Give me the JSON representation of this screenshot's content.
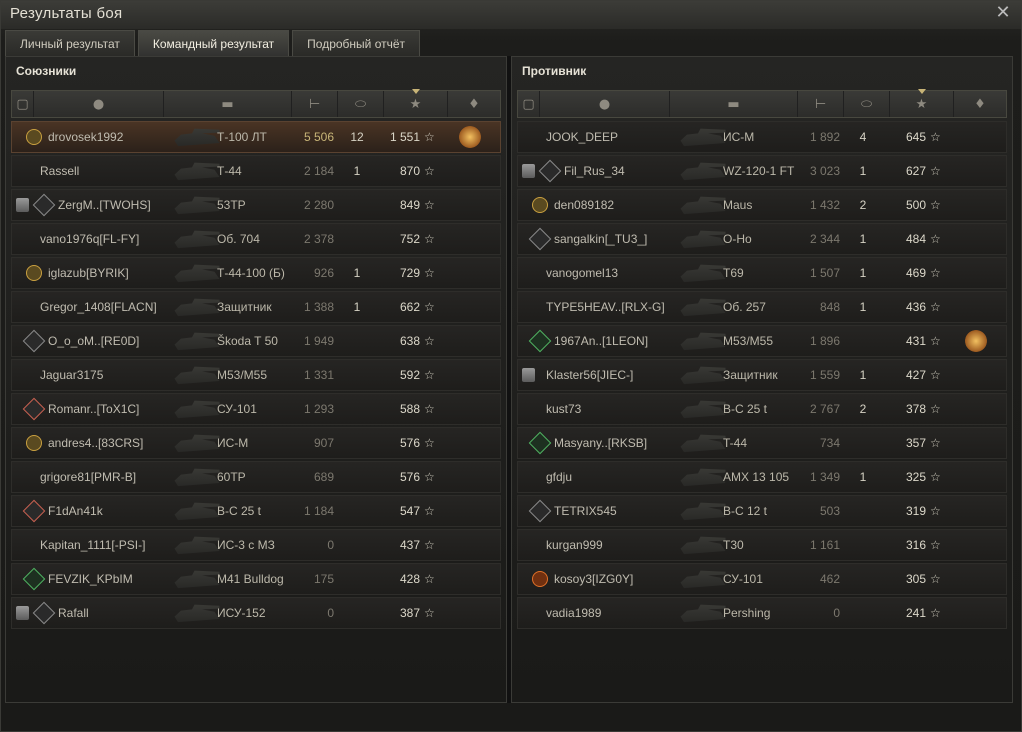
{
  "window": {
    "title": "Результаты боя"
  },
  "tabs": [
    {
      "label": "Личный результат",
      "active": false
    },
    {
      "label": "Командный результат",
      "active": true
    },
    {
      "label": "Подробный отчёт",
      "active": false
    }
  ],
  "allies": {
    "title": "Союзники",
    "rows": [
      {
        "name": "drovosek1992",
        "vehicle": "Т-100 ЛТ",
        "damage": "5 506",
        "kills": "12",
        "xp": "1 551",
        "squad": false,
        "badge": "gold",
        "medal": true,
        "me": true
      },
      {
        "name": "Rassell",
        "vehicle": "Т-44",
        "damage": "2 184",
        "kills": "1",
        "xp": "870",
        "squad": false,
        "badge": "",
        "medal": false
      },
      {
        "name": "ZergM..[TWOHS]",
        "vehicle": "53TP",
        "damage": "2 280",
        "kills": "",
        "xp": "849",
        "squad": true,
        "badge": "plain",
        "medal": false
      },
      {
        "name": "vano1976q[FL-FY]",
        "vehicle": "Об. 704",
        "damage": "2 378",
        "kills": "",
        "xp": "752",
        "squad": false,
        "badge": "",
        "medal": false
      },
      {
        "name": "iglazub[BYRIK]",
        "vehicle": "Т-44-100 (Б)",
        "damage": "926",
        "kills": "1",
        "xp": "729",
        "squad": false,
        "badge": "gold",
        "medal": false
      },
      {
        "name": "Gregor_1408[FLACN]",
        "vehicle": "Защитник",
        "damage": "1 388",
        "kills": "1",
        "xp": "662",
        "squad": false,
        "badge": "",
        "medal": false
      },
      {
        "name": "O_o_oM..[RE0D]",
        "vehicle": "Škoda T 50",
        "damage": "1 949",
        "kills": "",
        "xp": "638",
        "squad": false,
        "badge": "plain",
        "medal": false
      },
      {
        "name": "Jaguar3175",
        "vehicle": "M53/M55",
        "damage": "1 331",
        "kills": "",
        "xp": "592",
        "squad": false,
        "badge": "",
        "medal": false
      },
      {
        "name": "Romanr..[ToX1C]",
        "vehicle": "СУ-101",
        "damage": "1 293",
        "kills": "",
        "xp": "588",
        "squad": false,
        "badge": "red",
        "medal": false
      },
      {
        "name": "andres4..[83CRS]",
        "vehicle": "ИС-М",
        "damage": "907",
        "kills": "",
        "xp": "576",
        "squad": false,
        "badge": "gold",
        "medal": false
      },
      {
        "name": "grigore81[PMR-B]",
        "vehicle": "60TP",
        "damage": "689",
        "kills": "",
        "xp": "576",
        "squad": false,
        "badge": "",
        "medal": false
      },
      {
        "name": "F1dAn41k",
        "vehicle": "B-C 25 t",
        "damage": "1 184",
        "kills": "",
        "xp": "547",
        "squad": false,
        "badge": "red",
        "medal": false
      },
      {
        "name": "Kapitan_1111[-PSI-]",
        "vehicle": "ИС-3 с МЗ",
        "damage": "0",
        "kills": "",
        "xp": "437",
        "squad": false,
        "badge": "",
        "medal": false
      },
      {
        "name": "FEVZIK_KPbIM",
        "vehicle": "M41 Bulldog",
        "damage": "175",
        "kills": "",
        "xp": "428",
        "squad": false,
        "badge": "green",
        "medal": false
      },
      {
        "name": "Rafall",
        "vehicle": "ИСУ-152",
        "damage": "0",
        "kills": "",
        "xp": "387",
        "squad": true,
        "badge": "plain",
        "medal": false
      }
    ]
  },
  "enemies": {
    "title": "Противник",
    "rows": [
      {
        "name": "JOOK_DEEP",
        "vehicle": "ИС-М",
        "damage": "1 892",
        "kills": "4",
        "xp": "645",
        "squad": false,
        "badge": "",
        "medal": false
      },
      {
        "name": "Fil_Rus_34",
        "vehicle": "WZ-120-1 FT",
        "damage": "3 023",
        "kills": "1",
        "xp": "627",
        "squad": true,
        "badge": "plain",
        "medal": false
      },
      {
        "name": "den089182",
        "vehicle": "Maus",
        "damage": "1 432",
        "kills": "2",
        "xp": "500",
        "squad": false,
        "badge": "gold",
        "medal": false
      },
      {
        "name": "sangalkin[_TU3_]",
        "vehicle": "O-Ho",
        "damage": "2 344",
        "kills": "1",
        "xp": "484",
        "squad": false,
        "badge": "plain",
        "medal": false
      },
      {
        "name": "vanogomel13",
        "vehicle": "T69",
        "damage": "1 507",
        "kills": "1",
        "xp": "469",
        "squad": false,
        "badge": "",
        "medal": false
      },
      {
        "name": "TYPE5HEAV..[RLX-G]",
        "vehicle": "Об. 257",
        "damage": "848",
        "kills": "1",
        "xp": "436",
        "squad": false,
        "badge": "",
        "medal": false
      },
      {
        "name": "1967An..[1LEON]",
        "vehicle": "M53/M55",
        "damage": "1 896",
        "kills": "",
        "xp": "431",
        "squad": false,
        "badge": "green",
        "medal": true
      },
      {
        "name": "Klaster56[JIEC-]",
        "vehicle": "Защитник",
        "damage": "1 559",
        "kills": "1",
        "xp": "427",
        "squad": true,
        "badge": "",
        "medal": false
      },
      {
        "name": "kust73",
        "vehicle": "B-C 25 t",
        "damage": "2 767",
        "kills": "2",
        "xp": "378",
        "squad": false,
        "badge": "",
        "medal": false
      },
      {
        "name": "Masyany..[RKSB]",
        "vehicle": "T-44",
        "damage": "734",
        "kills": "",
        "xp": "357",
        "squad": false,
        "badge": "green",
        "medal": false
      },
      {
        "name": "gfdju",
        "vehicle": "AMX 13 105",
        "damage": "1 349",
        "kills": "1",
        "xp": "325",
        "squad": false,
        "badge": "",
        "medal": false
      },
      {
        "name": "TETRIX545",
        "vehicle": "B-C 12 t",
        "damage": "503",
        "kills": "",
        "xp": "319",
        "squad": false,
        "badge": "plain",
        "medal": false
      },
      {
        "name": "kurgan999",
        "vehicle": "T30",
        "damage": "1 161",
        "kills": "",
        "xp": "316",
        "squad": false,
        "badge": "",
        "medal": false
      },
      {
        "name": "kosoy3[IZG0Y]",
        "vehicle": "СУ-101",
        "damage": "462",
        "kills": "",
        "xp": "305",
        "squad": false,
        "badge": "orange",
        "medal": false
      },
      {
        "name": "vadia1989",
        "vehicle": "Pershing",
        "damage": "0",
        "kills": "",
        "xp": "241",
        "squad": false,
        "badge": "",
        "medal": false
      }
    ]
  },
  "columns": {
    "icons": [
      "squad-icon",
      "player-icon",
      "tank-icon",
      "damage-icon",
      "kills-icon",
      "xp-star-icon",
      "medal-icon"
    ],
    "star_glyph": "☆",
    "close_glyph": "✕"
  },
  "colors": {
    "self_row": "#4a3424",
    "damage_highlight": "#c8b578"
  }
}
